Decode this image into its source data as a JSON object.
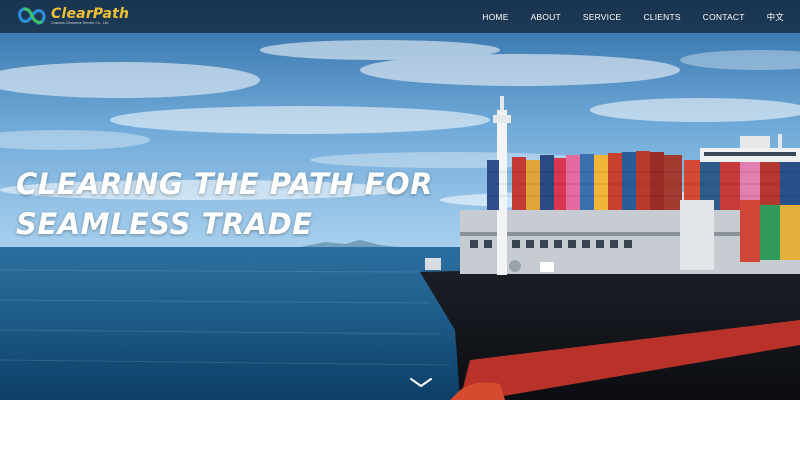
{
  "brand": {
    "name": "ClearPath",
    "tagline": "Customs Clearance Service Co., Ltd.",
    "colors": {
      "name": "#f2c133",
      "mark_blue": "#2b8fd6",
      "mark_green": "#3bbf6a"
    }
  },
  "nav": {
    "items": [
      {
        "label": "HOME"
      },
      {
        "label": "ABOUT"
      },
      {
        "label": "SERVICE"
      },
      {
        "label": "CLIENTS"
      },
      {
        "label": "CONTACT"
      },
      {
        "label": "中文"
      }
    ]
  },
  "hero": {
    "headline_line1": "CLEARING THE PATH FOR",
    "headline_line2": "SEAMLESS TRADE",
    "scroll_icon": "chevron-down-icon"
  }
}
